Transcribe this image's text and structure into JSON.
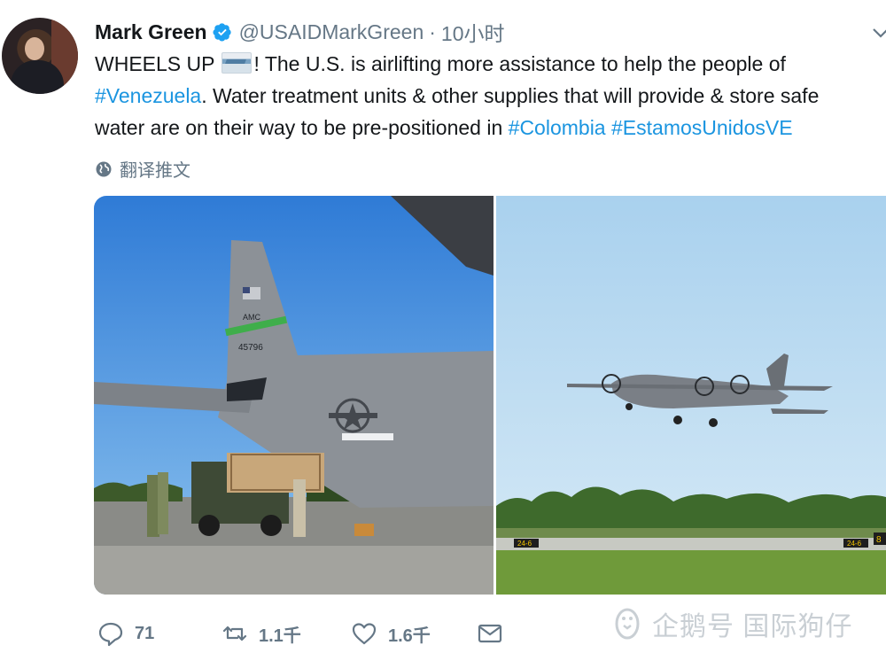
{
  "tweet": {
    "author": {
      "name": "Mark Green",
      "handle": "@USAIDMarkGreen",
      "verified": true
    },
    "separator": "·",
    "time": "10小时",
    "text": {
      "line1_before_emoji": "WHEELS UP ",
      "emoji": "airplane-flag-emoji",
      "line1_after_emoji": "! The U.S. is airlifting more assistance to help the people of",
      "hashtag_venezuela": "#Venezuela",
      "line2_rest": ". Water treatment units & other supplies that will provide & store safe",
      "line3_before_links": "water are on their way to be pre-positioned in ",
      "hashtag_colombia": "#Colombia",
      "hashtag_space": " ",
      "hashtag_estamos": "#EstamosUnidosVE"
    },
    "translate_label": "翻译推文",
    "media": [
      {
        "description_icon": "c130-tail-photo",
        "aircraft_text_1": "AMC",
        "aircraft_text_2": "45796"
      },
      {
        "description_icon": "c130-takeoff-photo",
        "runway_sign_1": "24-6",
        "runway_sign_2": "24-6",
        "runway_sign_3": "8"
      }
    ],
    "actions": {
      "reply_count": "71",
      "retweet_count": "1.1千",
      "like_count": "1.6千"
    },
    "watermark": "企鹅号 国际狗仔"
  },
  "colors": {
    "link": "#1b95e0",
    "secondary_text": "#657786",
    "verified": "#1da1f2"
  }
}
